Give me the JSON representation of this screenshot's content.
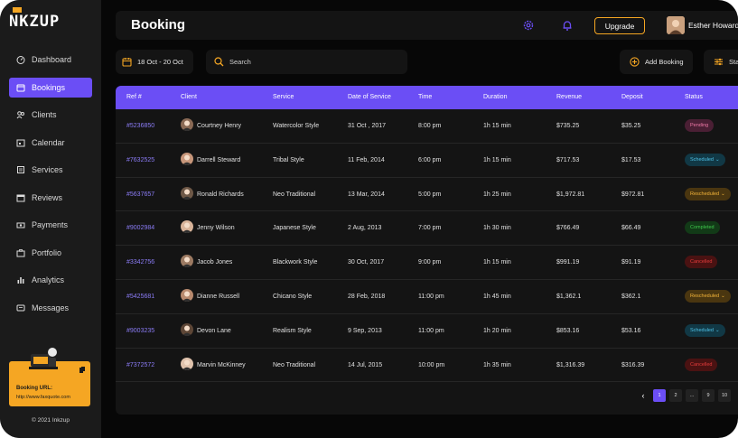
{
  "brand": {
    "name": "NKZUP",
    "accent": "#6b4ef5",
    "gold": "#f5a623"
  },
  "sidebar": {
    "items": [
      {
        "label": "Dashboard",
        "icon": "dashboard-icon",
        "active": false
      },
      {
        "label": "Bookings",
        "icon": "bookings-icon",
        "active": true
      },
      {
        "label": "Clients",
        "icon": "clients-icon",
        "active": false
      },
      {
        "label": "Calendar",
        "icon": "calendar-icon",
        "active": false
      },
      {
        "label": "Services",
        "icon": "services-icon",
        "active": false
      },
      {
        "label": "Reviews",
        "icon": "reviews-icon",
        "active": false
      },
      {
        "label": "Payments",
        "icon": "payments-icon",
        "active": false
      },
      {
        "label": "Portfolio",
        "icon": "portfolio-icon",
        "active": false
      },
      {
        "label": "Analytics",
        "icon": "analytics-icon",
        "active": false
      },
      {
        "label": "Messages",
        "icon": "messages-icon",
        "active": false
      }
    ],
    "promo": {
      "title": "Booking URL:",
      "url": "http://www.faxquote.com"
    },
    "copyright": "© 2021 Inkzup"
  },
  "header": {
    "title": "Booking",
    "upgrade_label": "Upgrade",
    "user_name": "Esther Howard"
  },
  "toolbar": {
    "date_range": "18 Oct - 20 Oct",
    "search_placeholder": "Search",
    "add_booking_label": "Add Booking",
    "filter_label": "Sta"
  },
  "table": {
    "columns": [
      "Ref #",
      "Client",
      "Service",
      "Date of Service",
      "Time",
      "Duration",
      "Revenue",
      "Deposit",
      "Status"
    ],
    "rows": [
      {
        "ref": "#5236850",
        "client": "Courtney Henry",
        "service": "Watercolor Style",
        "date": "31 Oct , 2017",
        "time": "8:00 pm",
        "duration": "1h 15 min",
        "revenue": "$735.25",
        "deposit": "$35.25",
        "status": "Pending"
      },
      {
        "ref": "#7632525",
        "client": "Darrell Steward",
        "service": "Tribal Style",
        "date": "11 Feb, 2014",
        "time": "6:00 pm",
        "duration": "1h 15 min",
        "revenue": "$717.53",
        "deposit": "$17.53",
        "status": "Scheduled"
      },
      {
        "ref": "#5637657",
        "client": "Ronald Richards",
        "service": "Neo Traditional",
        "date": "13 Mar, 2014",
        "time": "5:00 pm",
        "duration": "1h 25 min",
        "revenue": "$1,972.81",
        "deposit": "$972.81",
        "status": "Rescheduled"
      },
      {
        "ref": "#9002984",
        "client": "Jenny Wilson",
        "service": "Japanese Style",
        "date": "2 Aug, 2013",
        "time": "7:00 pm",
        "duration": "1h 30 min",
        "revenue": "$766.49",
        "deposit": "$66.49",
        "status": "Completed"
      },
      {
        "ref": "#3342756",
        "client": "Jacob Jones",
        "service": "Blackwork Style",
        "date": "30 Oct, 2017",
        "time": "9:00 pm",
        "duration": "1h 15 min",
        "revenue": "$991.19",
        "deposit": "$91.19",
        "status": "Cancelled"
      },
      {
        "ref": "#5425681",
        "client": "Dianne Russell",
        "service": "Chicano Style",
        "date": "28 Feb, 2018",
        "time": "11:00 pm",
        "duration": "1h 45 min",
        "revenue": "$1,362.1",
        "deposit": "$362.1",
        "status": "Rescheduled"
      },
      {
        "ref": "#9003235",
        "client": "Devon Lane",
        "service": "Realism Style",
        "date": "9 Sep, 2013",
        "time": "11:00 pm",
        "duration": "1h 20 min",
        "revenue": "$853.16",
        "deposit": "$53.16",
        "status": "Scheduled"
      },
      {
        "ref": "#7372572",
        "client": "Marvin McKinney",
        "service": "Neo Traditional",
        "date": "14 Jul, 2015",
        "time": "10:00 pm",
        "duration": "1h 35 min",
        "revenue": "$1,316.39",
        "deposit": "$316.39",
        "status": "Cancelled"
      }
    ]
  },
  "status_colors": {
    "Pending": {
      "bg": "#4a1f34",
      "fg": "#f07aa8"
    },
    "Scheduled": {
      "bg": "#113845",
      "fg": "#4fc3e8"
    },
    "Rescheduled": {
      "bg": "#4a3610",
      "fg": "#f5b53a"
    },
    "Completed": {
      "bg": "#123a17",
      "fg": "#3ec94c"
    },
    "Cancelled": {
      "bg": "#4a1212",
      "fg": "#e53b3b"
    }
  },
  "pagination": {
    "prev_icon": "chevron-left-icon",
    "pages": [
      "1",
      "2",
      "...",
      "9",
      "10"
    ],
    "current": "1"
  }
}
